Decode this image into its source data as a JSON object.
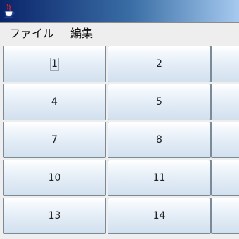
{
  "menubar": {
    "items": [
      {
        "label": "ファイル"
      },
      {
        "label": "編集"
      }
    ]
  },
  "grid": {
    "cells": [
      {
        "label": "1"
      },
      {
        "label": "2"
      },
      {
        "label": ""
      },
      {
        "label": "4"
      },
      {
        "label": "5"
      },
      {
        "label": ""
      },
      {
        "label": "7"
      },
      {
        "label": "8"
      },
      {
        "label": ""
      },
      {
        "label": "10"
      },
      {
        "label": "11"
      },
      {
        "label": ""
      },
      {
        "label": "13"
      },
      {
        "label": "14"
      },
      {
        "label": ""
      }
    ]
  },
  "colors": {
    "titlebar_start": "#0a246a",
    "titlebar_end": "#a6caf0",
    "button_border": "#7a8a99",
    "window_bg": "#eeeeee"
  },
  "icons": {
    "app": "java-coffee-cup-icon"
  }
}
